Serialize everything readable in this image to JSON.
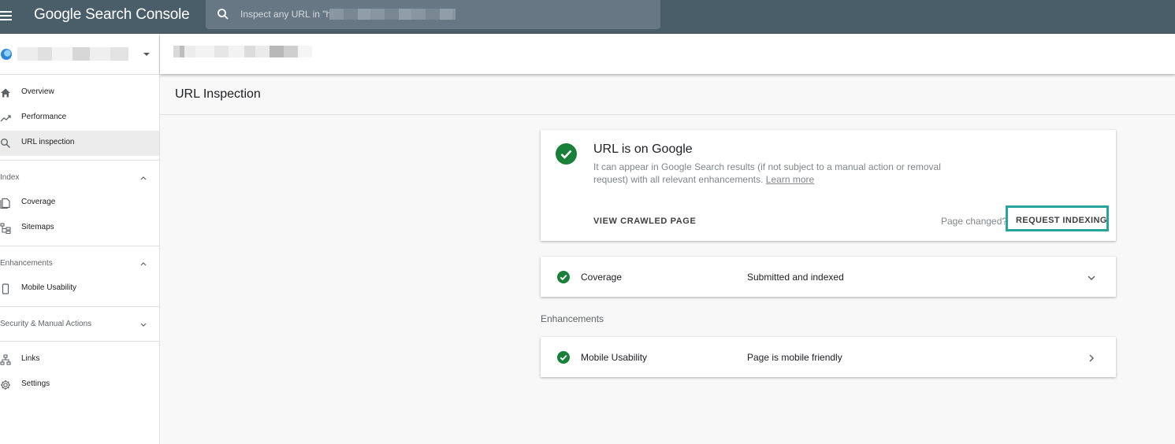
{
  "topbar": {
    "brand": "Google Search Console",
    "search_placeholder": "Inspect any URL in \"ht"
  },
  "sidebar": {
    "items": [
      {
        "label": "Overview",
        "icon": "home-icon"
      },
      {
        "label": "Performance",
        "icon": "trending-up-icon"
      },
      {
        "label": "URL inspection",
        "icon": "search-icon",
        "active": true
      }
    ],
    "sections": [
      {
        "label": "Index",
        "expanded": true,
        "items": [
          {
            "label": "Coverage",
            "icon": "document-icon"
          },
          {
            "label": "Sitemaps",
            "icon": "sitemap-icon"
          }
        ]
      },
      {
        "label": "Enhancements",
        "expanded": true,
        "items": [
          {
            "label": "Mobile Usability",
            "icon": "phone-icon"
          }
        ]
      },
      {
        "label": "Security & Manual Actions",
        "expanded": false,
        "items": []
      }
    ],
    "bottom_items": [
      {
        "label": "Links",
        "icon": "links-icon"
      },
      {
        "label": "Settings",
        "icon": "gear-icon"
      }
    ]
  },
  "main": {
    "title": "URL Inspection",
    "status_card": {
      "title": "URL is on Google",
      "description": "It can appear in Google Search results (if not subject to a manual action or removal request) with all relevant enhancements.",
      "learn_more": "Learn more",
      "view_crawled": "VIEW CRAWLED PAGE",
      "page_changed": "Page changed?",
      "request_indexing": "REQUEST INDEXING"
    },
    "coverage": {
      "name": "Coverage",
      "value": "Submitted and indexed"
    },
    "enhancements_label": "Enhancements",
    "mobile_usability": {
      "name": "Mobile Usability",
      "value": "Page is mobile friendly"
    }
  },
  "colors": {
    "topbar": "#4a5e6a",
    "success_green": "#188038",
    "highlight_teal": "#26a69a"
  }
}
